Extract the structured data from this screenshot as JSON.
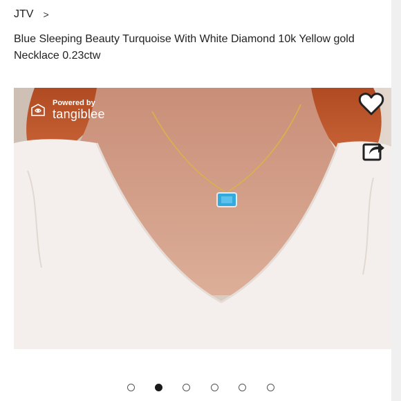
{
  "breadcrumb": {
    "store": "JTV",
    "separator": ">"
  },
  "product": {
    "title": "Blue Sleeping Beauty Turquoise With White Diamond 10k Yellow gold Necklace 0.23ctw"
  },
  "gallery": {
    "badge": {
      "powered_by": "Powered by",
      "brand": "tangiblee"
    },
    "favorite_icon": "heart-outline-icon",
    "share_icon": "share-arrow-icon",
    "slide_count": 6,
    "active_slide": 2
  },
  "colors": {
    "skin": "#d9a993",
    "hair": "#c2582c",
    "shirt": "#f5f1ee",
    "gold_chain": "#d8b24a",
    "turquoise": "#35a8dc",
    "dot_active": "#1a1a1a"
  }
}
